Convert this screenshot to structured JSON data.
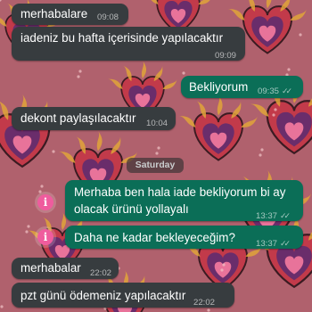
{
  "theme": {
    "wallpaper": "#b0616d",
    "incoming_bubble": "#373c3f",
    "outgoing_bubble": "#0b6e57",
    "info_icon": "#ef5c9e"
  },
  "messages_before": [
    {
      "direction": "incoming",
      "text": "merhabalare",
      "time": "09:08"
    },
    {
      "direction": "incoming",
      "text": "iadeniz bu hafta içerisinde yapılacaktır",
      "time": "09:09"
    },
    {
      "direction": "outgoing",
      "text": "Bekliyorum",
      "time": "09:35",
      "status": "read"
    },
    {
      "direction": "incoming",
      "text": "dekont paylaşılacaktır",
      "time": "10:04"
    }
  ],
  "date_separator": "Saturday",
  "messages_after": [
    {
      "direction": "outgoing",
      "text_line1": "Merhaba ben hala iade bekliyorum bi ay",
      "text_line2": "olacak ürünü yollayalı",
      "time": "13:37",
      "status": "read",
      "icon": "info-icon"
    },
    {
      "direction": "outgoing",
      "text": "Daha ne kadar bekleyeceğim?",
      "time": "13:37",
      "status": "read",
      "icon": "info-icon"
    },
    {
      "direction": "incoming",
      "text": "merhabalar",
      "time": "22:02"
    },
    {
      "direction": "incoming",
      "text": "pzt günü ödemeniz yapılacaktır",
      "time": "22:02"
    }
  ],
  "icons": {
    "read_ticks": "✓✓",
    "info_glyph": "i"
  }
}
